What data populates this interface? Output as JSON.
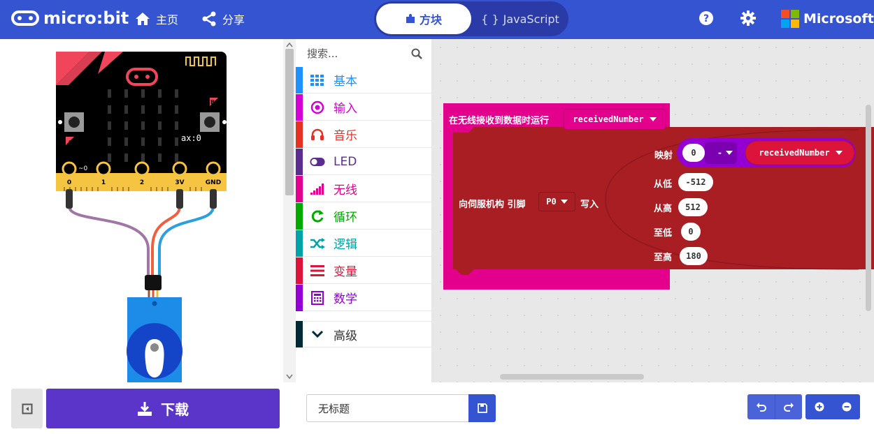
{
  "header": {
    "logo_text": "micro:bit",
    "home_label": "主页",
    "share_label": "分享",
    "blocks_label": "方块",
    "js_braces": "{ }",
    "js_label": "JavaScript",
    "brand": "Microsoft"
  },
  "simulator": {
    "readout": "ax:0",
    "pin_labels": [
      "0",
      "1",
      "2",
      "3V",
      "GND"
    ],
    "pin_zero_mark": "~0",
    "button_a": "A",
    "button_b": "B"
  },
  "toolbox": {
    "search_placeholder": "搜索...",
    "categories": [
      {
        "label": "基本",
        "color": "#1e90ff",
        "icon": "grid-icon"
      },
      {
        "label": "输入",
        "color": "#d400d4",
        "icon": "target-icon"
      },
      {
        "label": "音乐",
        "color": "#e63022",
        "icon": "headphones-icon"
      },
      {
        "label": "LED",
        "color": "#5c2d91",
        "icon": "toggle-icon"
      },
      {
        "label": "无线",
        "color": "#e3008c",
        "icon": "signal-icon"
      },
      {
        "label": "循环",
        "color": "#00aa00",
        "icon": "loop-icon"
      },
      {
        "label": "逻辑",
        "color": "#00a4a6",
        "icon": "shuffle-icon"
      },
      {
        "label": "变量",
        "color": "#dc143c",
        "icon": "list-icon"
      },
      {
        "label": "数学",
        "color": "#9400d3",
        "icon": "calculator-icon"
      }
    ],
    "advanced_label": "高级",
    "advanced_color": "#002b36"
  },
  "workspace": {
    "event_label": "在无线接收到数据时运行",
    "event_param": "receivedNumber",
    "servo_label": "向伺服机构 引脚",
    "servo_pin": "P0",
    "servo_write": "写入",
    "map_label": "映射",
    "map_value": "0",
    "map_op": "-",
    "map_var": "receivedNumber",
    "from_low_label": "从低",
    "from_low_value": "-512",
    "from_high_label": "从高",
    "from_high_value": "512",
    "to_low_label": "至低",
    "to_low_value": "0",
    "to_high_label": "至高",
    "to_high_value": "180",
    "colors": {
      "radio": "#e3008c",
      "servo": "#a81e23",
      "math": "#9400d3",
      "variable": "#dc143c"
    }
  },
  "bottom": {
    "download_label": "下载",
    "project_name": "无标题"
  }
}
